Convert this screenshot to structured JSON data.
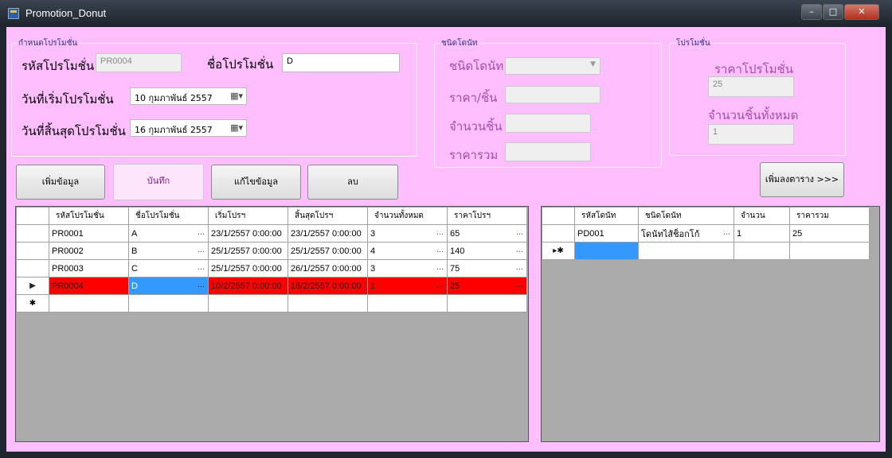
{
  "window": {
    "title": "Promotion_Donut",
    "min": "–",
    "max": "□",
    "close": "✕"
  },
  "promo_group": {
    "title": "กำหนดโปรโมชั่น",
    "code_label": "รหัสโปรโมชั่น",
    "code_value": "PR0004",
    "name_label": "ชื่อโปรโมชั่น",
    "name_value": "D",
    "start_label": "วันที่เริ่มโปรโมชั่น",
    "start_value": "10  กุมภาพันธ์  2557",
    "end_label": "วันที่สิ้นสุดโปรโมชั่น",
    "end_value": "16  กุมภาพันธ์  2557"
  },
  "donut_group": {
    "title": "ชนิดโดนัท",
    "type_label": "ชนิดโดนัท",
    "type_value": "",
    "price_label": "ราคา/ชิ้น",
    "price_value": "",
    "qty_label": "จำนวนชิ้น",
    "qty_value": "",
    "total_label": "ราคารวม",
    "total_value": ""
  },
  "summary_group": {
    "title": "โปรโมชั่น",
    "price_label": "ราคาโปรโมชั่น",
    "price_value": "25",
    "count_label": "จำนวนชิ้นทั้งหมด",
    "count_value": "1"
  },
  "buttons": {
    "add": "เพิ่มข้อมูล",
    "save": "บันทึก",
    "edit": "แก้ไขข้อมูล",
    "delete": "ลบ",
    "add_to_table": "เพิ่มลงตาราง >>>"
  },
  "promo_table": {
    "columns": [
      "รหัสโปรโมชั่น",
      "ชื่อโปรโมชั่น",
      "เริ่มโปรฯ",
      "สิ้นสุดโปรฯ",
      "จำนวนทั้งหมด",
      "ราคาโปรฯ"
    ],
    "rows": [
      [
        "PR0001",
        "A",
        "23/1/2557 0:00:00",
        "23/1/2557 0:00:00",
        "3",
        "65"
      ],
      [
        "PR0002",
        "B",
        "25/1/2557 0:00:00",
        "25/1/2557 0:00:00",
        "4",
        "140"
      ],
      [
        "PR0003",
        "C",
        "25/1/2557 0:00:00",
        "26/1/2557 0:00:00",
        "3",
        "75"
      ],
      [
        "PR0004",
        "D",
        "10/2/2557 0:00:00",
        "16/2/2557 0:00:00",
        "1",
        "25"
      ]
    ],
    "selected_row": 3,
    "new_row_marker": "✱",
    "current_row_marker": "▶"
  },
  "donut_table": {
    "columns": [
      "รหัสโดนัท",
      "ชนิดโดนัท",
      "จำนวน",
      "ราคารวม"
    ],
    "rows": [
      [
        "PD001",
        "โดนัทไส้ช็อกโก้",
        "1",
        "25"
      ]
    ],
    "new_row_marker": "▸✱"
  }
}
